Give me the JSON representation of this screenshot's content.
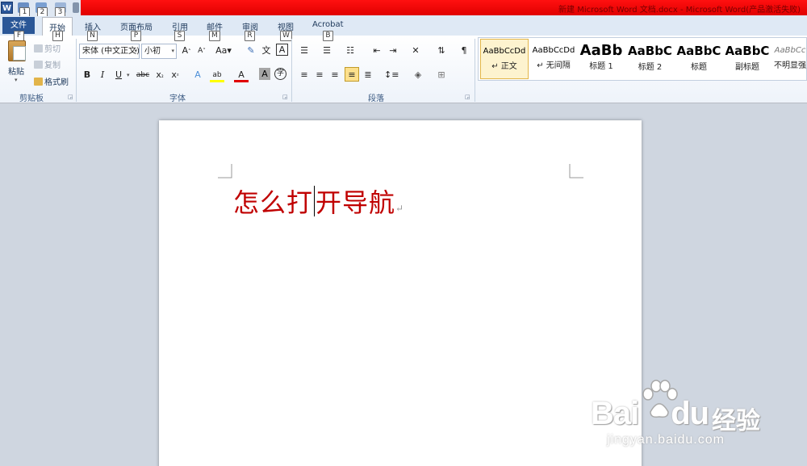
{
  "window": {
    "title": "新建 Microsoft Word 文档.docx - Microsoft Word(产品激活失败)",
    "app_logo": "W"
  },
  "qat": {
    "keytips": [
      "1",
      "2",
      "3"
    ]
  },
  "tabs": [
    {
      "label": "文件",
      "keytip": "F"
    },
    {
      "label": "开始",
      "keytip": "H"
    },
    {
      "label": "插入",
      "keytip": "N"
    },
    {
      "label": "页面布局",
      "keytip": "P"
    },
    {
      "label": "引用",
      "keytip": "S"
    },
    {
      "label": "邮件",
      "keytip": "M"
    },
    {
      "label": "审阅",
      "keytip": "R"
    },
    {
      "label": "视图",
      "keytip": "W"
    },
    {
      "label": "Acrobat",
      "keytip": "B"
    }
  ],
  "clipboard": {
    "paste": "粘贴",
    "cut": "剪切",
    "copy": "复制",
    "format_painter": "格式刷",
    "group": "剪贴板"
  },
  "font": {
    "name": "宋体 (中文正文)",
    "size": "小初",
    "group": "字体"
  },
  "paragraph": {
    "group": "段落"
  },
  "styles": [
    {
      "sample": "AaBbCcDd",
      "name": "↵ 正文"
    },
    {
      "sample": "AaBbCcDd",
      "name": "↵ 无间隔"
    },
    {
      "sample": "AaBb",
      "name": "标题 1"
    },
    {
      "sample": "AaBbC",
      "name": "标题 2"
    },
    {
      "sample": "AaBbC",
      "name": "标题"
    },
    {
      "sample": "AaBbC",
      "name": "副标题"
    },
    {
      "sample": "AaBbCc",
      "name": "不明显强"
    }
  ],
  "document": {
    "text_before_caret": "怎么打",
    "text_after_caret": "开导航",
    "para_mark": "↵"
  },
  "watermark": {
    "logo_left": "Bai",
    "logo_right": "du",
    "cn": "经验",
    "url": "jingyan.baidu.com"
  },
  "colors": {
    "accent_red": "#e00000",
    "doc_text": "#c00000",
    "file_tab": "#2b5797"
  }
}
